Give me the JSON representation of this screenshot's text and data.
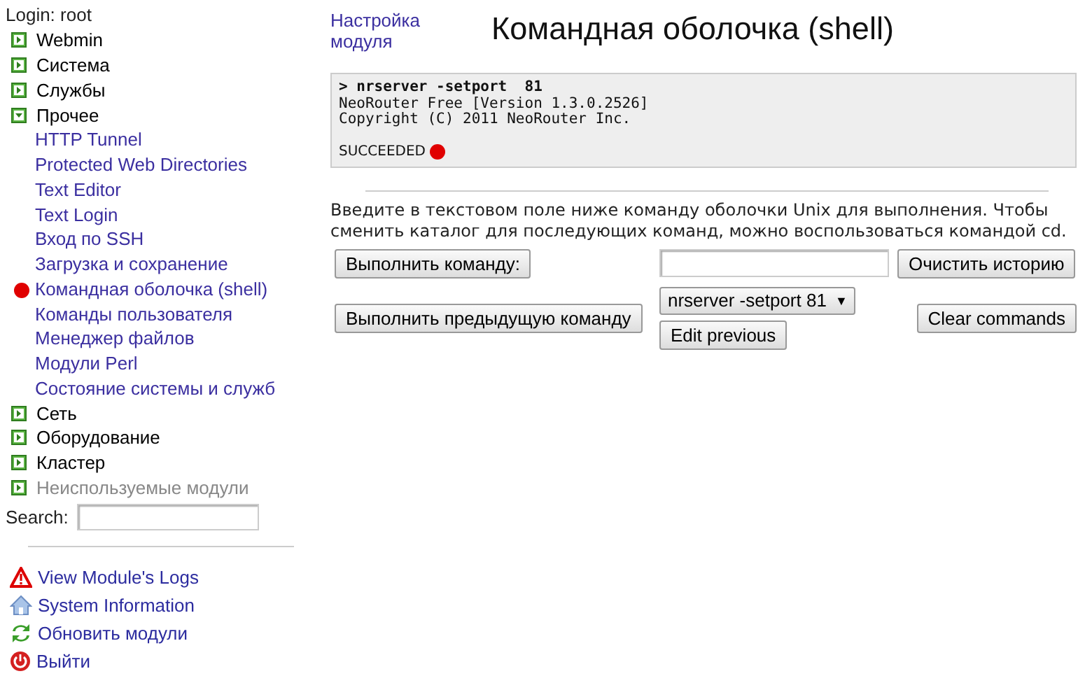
{
  "login": "Login: root",
  "menu": [
    {
      "kind": "category",
      "label": "Webmin",
      "expanded": false,
      "dimmed": false
    },
    {
      "kind": "category",
      "label": "Система",
      "expanded": false,
      "dimmed": false
    },
    {
      "kind": "category",
      "label": "Службы",
      "expanded": false,
      "dimmed": false
    },
    {
      "kind": "category",
      "label": "Прочее",
      "expanded": true,
      "dimmed": false,
      "children": [
        {
          "label": "HTTP Tunnel",
          "selected": false
        },
        {
          "label": "Protected Web Directories",
          "selected": false
        },
        {
          "label": "Text Editor",
          "selected": false
        },
        {
          "label": "Text Login",
          "selected": false
        },
        {
          "label": "Вход по SSH",
          "selected": false
        },
        {
          "label": "Загрузка и сохранение",
          "selected": false
        },
        {
          "label": "Командная оболочка (shell)",
          "selected": true
        },
        {
          "label": "Команды пользователя",
          "selected": false
        },
        {
          "label": "Менеджер файлов",
          "selected": false
        },
        {
          "label": "Модули Perl",
          "selected": false
        },
        {
          "label": "Состояние системы и служб",
          "selected": false
        }
      ]
    },
    {
      "kind": "category",
      "label": "Сеть",
      "expanded": false,
      "dimmed": false
    },
    {
      "kind": "category",
      "label": "Оборудование",
      "expanded": false,
      "dimmed": false
    },
    {
      "kind": "category",
      "label": "Кластер",
      "expanded": false,
      "dimmed": false
    },
    {
      "kind": "category",
      "label": "Неиспользуемые модули",
      "expanded": false,
      "dimmed": true
    }
  ],
  "search": {
    "label": "Search:"
  },
  "links": [
    {
      "kind": "logs",
      "label": "View Module's Logs"
    },
    {
      "kind": "info",
      "label": "System Information"
    },
    {
      "kind": "refresh",
      "label": "Обновить модули"
    },
    {
      "kind": "logout",
      "label": "Выйти"
    }
  ],
  "config_link": "Настройка модуля",
  "title": "Командная оболочка (shell)",
  "output": {
    "command": "> nrserver -setport  81",
    "lines": [
      "NeoRouter Free [Version 1.3.0.2526]",
      "Copyright (C) 2011 NeoRouter Inc."
    ],
    "status": "SUCCEEDED",
    "color": "#e00000"
  },
  "help": "Введите в текстовом поле ниже команду оболочки Unix для выполнения. Чтобы сменить каталог для последующих команд, можно воспользоваться командой cd.",
  "buttons": {
    "run": "Выполнить команду:",
    "clear_history": "Очистить историю",
    "run_previous": "Выполнить предыдущую команду",
    "previous": "nrserver -setport 81",
    "previous_caret": "▼",
    "edit_previous": "Edit previous",
    "clear_commands": "Clear commands"
  }
}
